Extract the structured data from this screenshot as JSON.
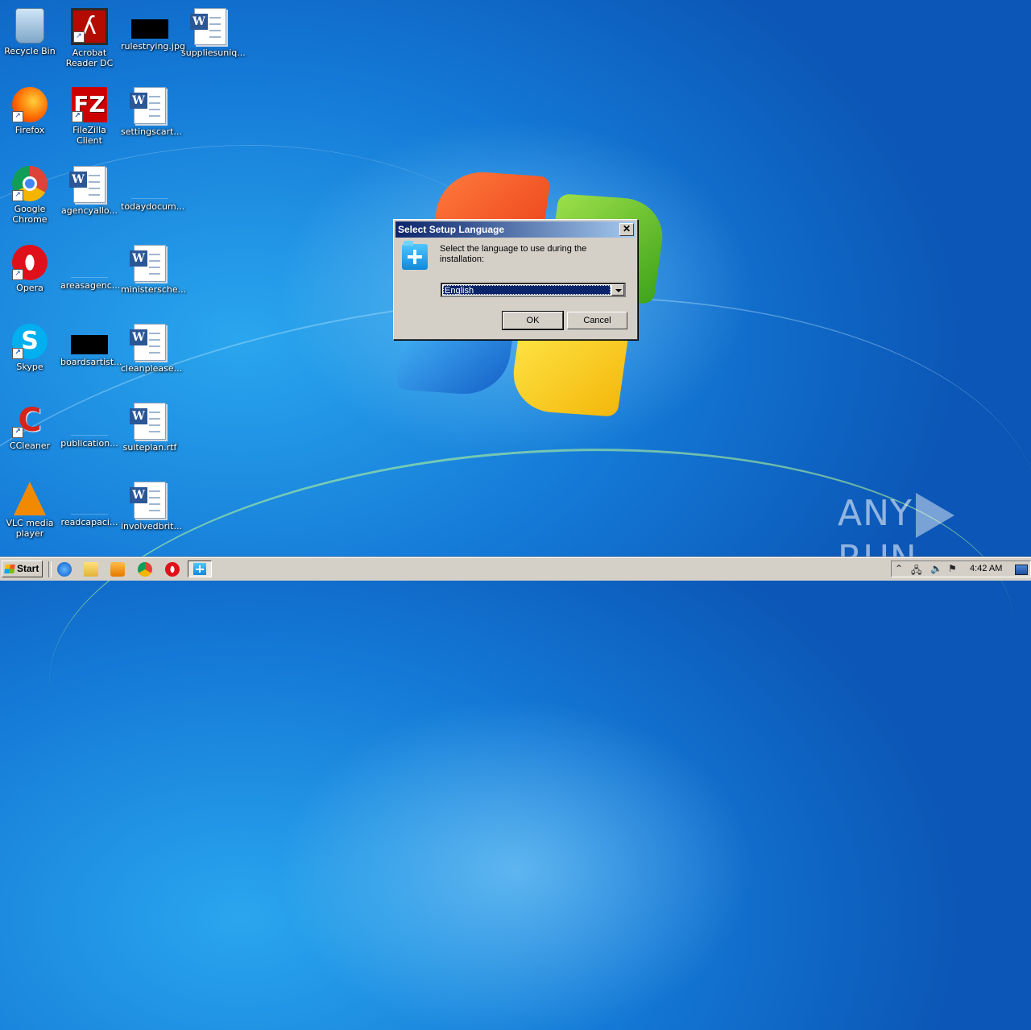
{
  "desktop": {
    "icons": [
      {
        "label": "Recycle Bin",
        "icon": "recycle-bin-icon"
      },
      {
        "label": "Acrobat Reader DC",
        "icon": "acrobat-reader-icon"
      },
      {
        "label": "rulestrying.jpg",
        "icon": "image-file-icon"
      },
      {
        "label": "suppliesuniq...",
        "icon": "word-doc-icon"
      },
      {
        "label": "Firefox",
        "icon": "firefox-icon"
      },
      {
        "label": "FileZilla Client",
        "icon": "filezilla-icon"
      },
      {
        "label": "settingscart...",
        "icon": "word-doc-icon"
      },
      {
        "label": "Google Chrome",
        "icon": "chrome-icon"
      },
      {
        "label": "agencyallo...",
        "icon": "word-doc-icon"
      },
      {
        "label": "todaydocum...",
        "icon": "blank-file-icon"
      },
      {
        "label": "Opera",
        "icon": "opera-icon"
      },
      {
        "label": "areasagenc...",
        "icon": "blank-file-icon"
      },
      {
        "label": "ministersche...",
        "icon": "word-doc-icon"
      },
      {
        "label": "Skype",
        "icon": "skype-icon"
      },
      {
        "label": "boardsartist...",
        "icon": "image-file-icon"
      },
      {
        "label": "cleanplease...",
        "icon": "word-doc-icon"
      },
      {
        "label": "CCleaner",
        "icon": "ccleaner-icon"
      },
      {
        "label": "publication...",
        "icon": "blank-file-icon"
      },
      {
        "label": "suiteplan.rtf",
        "icon": "word-doc-icon"
      },
      {
        "label": "VLC media player",
        "icon": "vlc-icon"
      },
      {
        "label": "readcapaci...",
        "icon": "blank-file-icon"
      },
      {
        "label": "involvedbrit...",
        "icon": "word-doc-icon"
      }
    ]
  },
  "dialog": {
    "title": "Select Setup Language",
    "close_label": "✕",
    "prompt": "Select the language to use during the installation:",
    "language_selected": "English",
    "ok_label": "OK",
    "cancel_label": "Cancel"
  },
  "watermark": {
    "left": "ANY",
    "right": "RUN"
  },
  "taskbar": {
    "start_label": "Start",
    "clock": "4:42 AM",
    "tray_expand": "⌃",
    "tray_network": "🖧",
    "tray_volume": "🔈",
    "tray_flag": "⚑"
  }
}
